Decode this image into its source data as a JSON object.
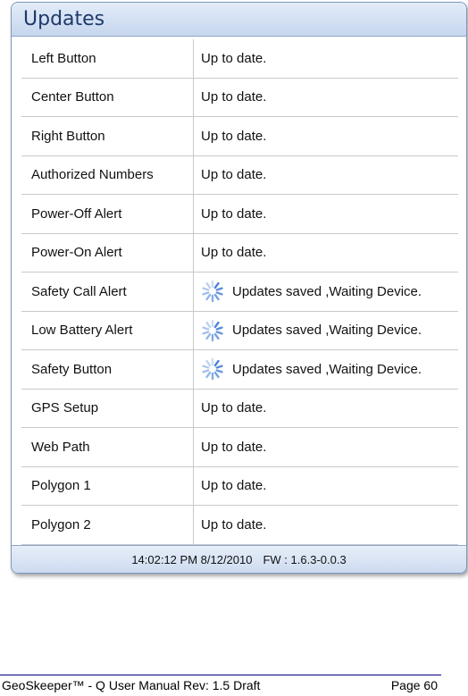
{
  "panel": {
    "title": "Updates",
    "rows": [
      {
        "name": "Left Button",
        "status": "Up to date.",
        "pending": false
      },
      {
        "name": "Center Button",
        "status": "Up to date.",
        "pending": false
      },
      {
        "name": "Right Button",
        "status": "Up to date.",
        "pending": false
      },
      {
        "name": "Authorized Numbers",
        "status": "Up to date.",
        "pending": false
      },
      {
        "name": "Power-Off Alert",
        "status": "Up to date.",
        "pending": false
      },
      {
        "name": "Power-On Alert",
        "status": "Up to date.",
        "pending": false
      },
      {
        "name": "Safety Call Alert",
        "status": "Updates saved ,Waiting Device.",
        "pending": true
      },
      {
        "name": "Low Battery Alert",
        "status": "Updates saved ,Waiting Device.",
        "pending": true
      },
      {
        "name": "Safety Button",
        "status": "Updates saved ,Waiting Device.",
        "pending": true
      },
      {
        "name": "GPS Setup",
        "status": "Up to date.",
        "pending": false
      },
      {
        "name": "Web Path",
        "status": "Up to date.",
        "pending": false
      },
      {
        "name": "Polygon 1",
        "status": "Up to date.",
        "pending": false
      },
      {
        "name": "Polygon 2",
        "status": "Up to date.",
        "pending": false
      }
    ],
    "footer": {
      "timestamp": "14:02:12 PM 8/12/2010",
      "firmware": "FW : 1.6.3-0.0.3"
    }
  },
  "page_footer": {
    "document": "GeoSkeeper™ - Q User Manual Rev: 1.5 Draft",
    "page": "Page 60"
  },
  "icons": {
    "pending": "loading-spinner-icon"
  },
  "colors": {
    "header_text": "#1e3a68",
    "spinner": "#3b79d6",
    "border": "#7d97bd"
  }
}
